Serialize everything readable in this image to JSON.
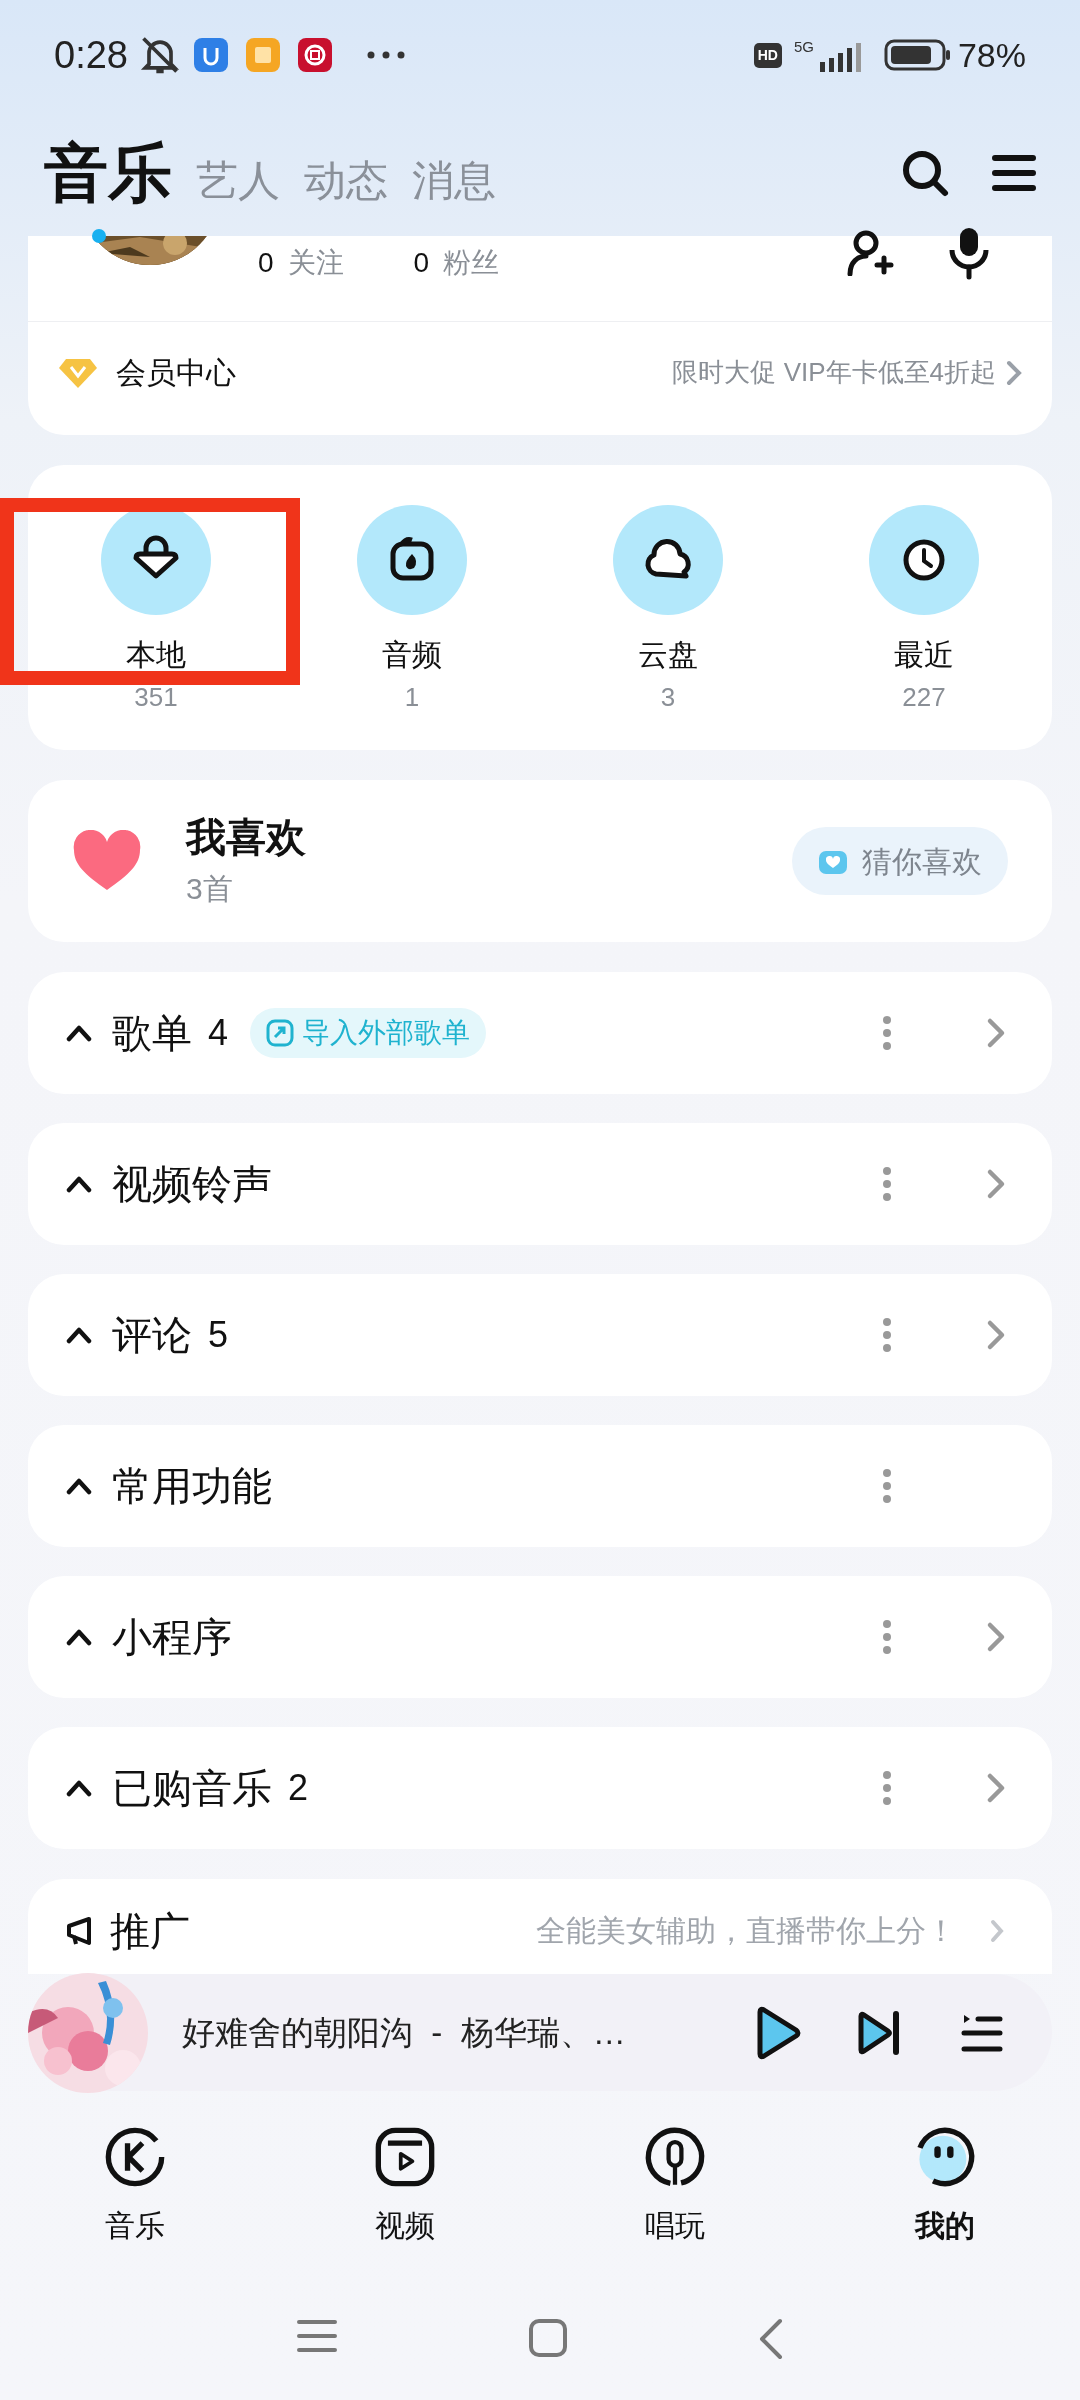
{
  "status_bar": {
    "time": "0:28",
    "hd": "HD",
    "network": "5G",
    "battery": "78%"
  },
  "header": {
    "tabs": [
      {
        "label": "音乐",
        "selected": true
      },
      {
        "label": "艺人",
        "selected": false
      },
      {
        "label": "动态",
        "selected": false
      },
      {
        "label": "消息",
        "selected": false
      }
    ]
  },
  "profile": {
    "stats": [
      {
        "value": "0",
        "label": "关注"
      },
      {
        "value": "0",
        "label": "粉丝"
      }
    ],
    "vip": {
      "label": "会员中心",
      "promo": "限时大促 VIP年卡低至4折起"
    }
  },
  "shortcuts": [
    {
      "label": "本地",
      "count": "351",
      "highlighted": true
    },
    {
      "label": "音频",
      "count": "1",
      "highlighted": false
    },
    {
      "label": "云盘",
      "count": "3",
      "highlighted": false
    },
    {
      "label": "最近",
      "count": "227",
      "highlighted": false
    }
  ],
  "favorites": {
    "title": "我喜欢",
    "count": "3首",
    "button": "猜你喜欢"
  },
  "sections": [
    {
      "title": "歌单",
      "count": "4",
      "badge": "导入外部歌单",
      "arrow": true
    },
    {
      "title": "视频铃声",
      "arrow": true
    },
    {
      "title": "评论",
      "count": "5",
      "arrow": true
    },
    {
      "title": "常用功能",
      "arrow": false
    },
    {
      "title": "小程序",
      "arrow": true
    },
    {
      "title": "已购音乐",
      "count": "2",
      "arrow": true
    }
  ],
  "promo": {
    "label": "推广",
    "text": "全能美女辅助，直播带你上分！"
  },
  "player": {
    "title": "好难舍的朝阳沟  -  杨华瑞、…"
  },
  "bottom_nav": [
    {
      "label": "音乐",
      "selected": false
    },
    {
      "label": "视频",
      "selected": false
    },
    {
      "label": "唱玩",
      "selected": false
    },
    {
      "label": "我的",
      "selected": true
    }
  ]
}
